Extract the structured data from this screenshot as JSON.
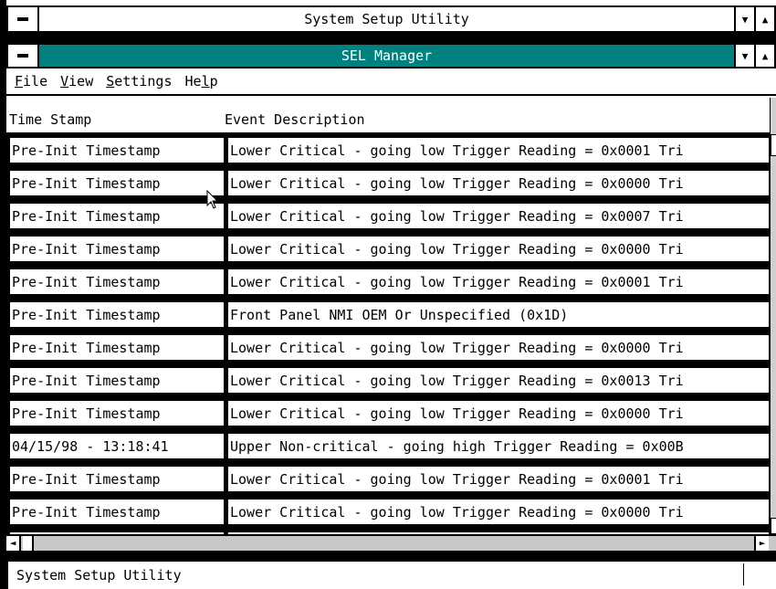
{
  "window": {
    "title": "System Setup Utility"
  },
  "dialog": {
    "title": "SEL Manager"
  },
  "menu": [
    {
      "label": "File",
      "accel": "F",
      "rest": "ile"
    },
    {
      "label": "View",
      "accel": "V",
      "rest": "iew"
    },
    {
      "label": "Settings",
      "accel": "S",
      "rest": "ettings"
    },
    {
      "label": "Help",
      "pre": "He",
      "accel": "l",
      "rest": "p"
    }
  ],
  "table": {
    "columns": [
      "Time Stamp",
      "Event Description"
    ],
    "rows": [
      [
        "Pre-Init Timestamp",
        "Lower Critical - going low Trigger Reading = 0x0001 Tri"
      ],
      [
        "Pre-Init Timestamp",
        "Lower Critical - going low Trigger Reading = 0x0000 Tri"
      ],
      [
        "Pre-Init Timestamp",
        "Lower Critical - going low Trigger Reading = 0x0007 Tri"
      ],
      [
        "Pre-Init Timestamp",
        "Lower Critical - going low Trigger Reading = 0x0000 Tri"
      ],
      [
        "Pre-Init Timestamp",
        "Lower Critical - going low Trigger Reading = 0x0001 Tri"
      ],
      [
        "Pre-Init Timestamp",
        "Front Panel NMI OEM Or Unspecified (0x1D)"
      ],
      [
        "Pre-Init Timestamp",
        "Lower Critical - going low Trigger Reading = 0x0000 Tri"
      ],
      [
        "Pre-Init Timestamp",
        "Lower Critical - going low Trigger Reading = 0x0013 Tri"
      ],
      [
        "Pre-Init Timestamp",
        "Lower Critical - going low Trigger Reading = 0x0000 Tri"
      ],
      [
        "04/15/98 - 13:18:41",
        "Upper Non-critical - going high Trigger Reading = 0x00B"
      ],
      [
        "Pre-Init Timestamp",
        "Lower Critical - going low Trigger Reading = 0x0001 Tri"
      ],
      [
        "Pre-Init Timestamp",
        "Lower Critical - going low Trigger Reading = 0x0000 Tri"
      ],
      [
        "",
        ""
      ]
    ]
  },
  "statusbar": {
    "text": "System Setup Utility"
  },
  "icons": {
    "system_menu": "system-menu-icon",
    "dropdown": "triangle-down-icon",
    "maximize": "triangle-up-icon",
    "scroll_left": "arrow-left-icon",
    "scroll_right": "arrow-right-icon",
    "cursor": "mouse-pointer-icon"
  }
}
